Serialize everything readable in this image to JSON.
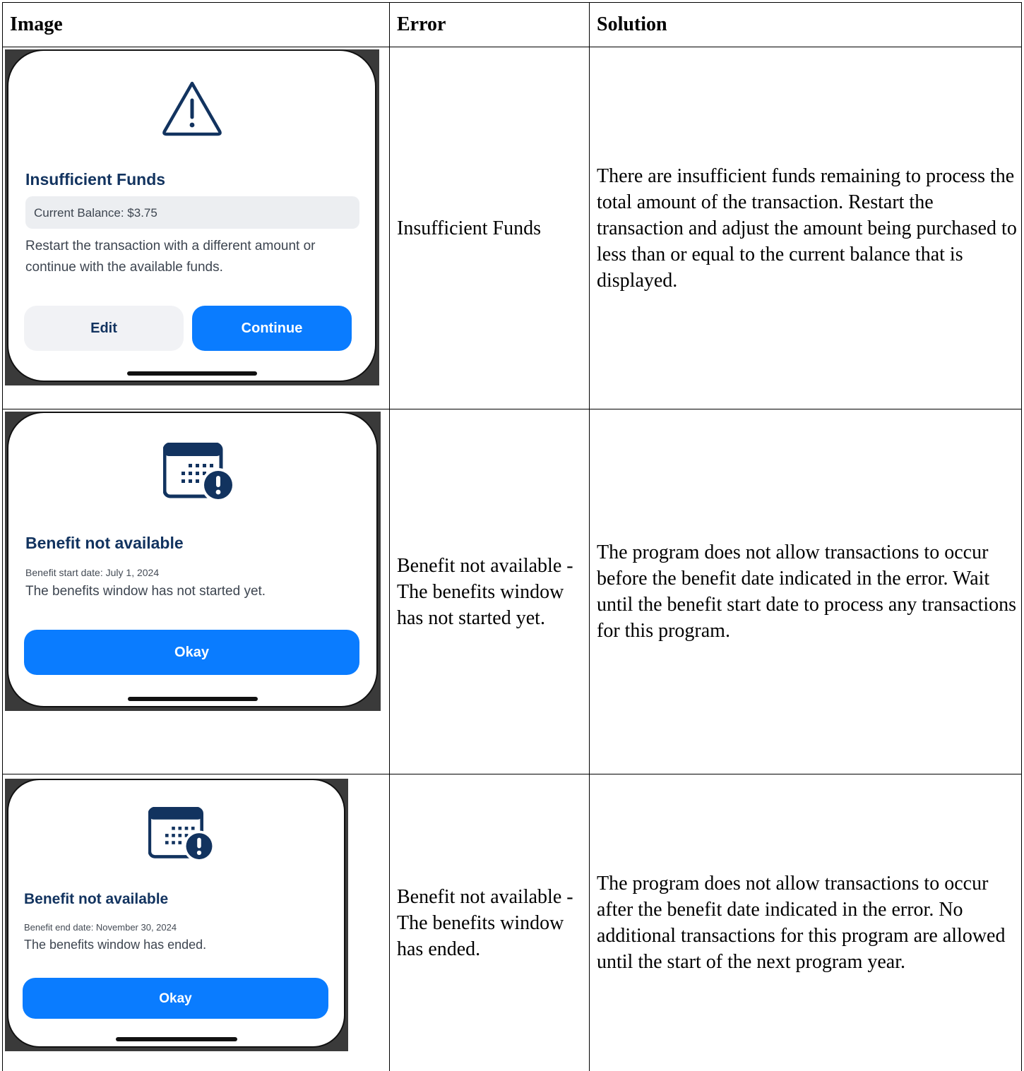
{
  "table": {
    "headers": [
      "Image",
      "Error",
      "Solution"
    ],
    "rows": [
      {
        "error": "Insufficient Funds",
        "solution": "There are insufficient funds remaining to process the total amount of the transaction. Restart the transaction and adjust the amount being purchased to less than or equal to the current balance that is displayed.",
        "dialog": {
          "icon": "warning-triangle-icon",
          "title": "Insufficient Funds",
          "balance": "Current Balance: $3.75",
          "body": "Restart the transaction with a different amount or continue with the available funds.",
          "buttons": [
            "Edit",
            "Continue"
          ]
        }
      },
      {
        "error": "Benefit not available - The benefits window has not started yet.",
        "solution": "The program does not allow transactions to occur before the benefit date indicated in the error. Wait until the benefit start date to process any transactions for this program.",
        "dialog": {
          "icon": "calendar-alert-icon",
          "title": "Benefit not available",
          "date_line": "Benefit start date: July 1, 2024",
          "body": "The benefits window has not started yet.",
          "button": "Okay"
        }
      },
      {
        "error": "Benefit not available - The benefits window has ended.",
        "solution": "The program does not allow transactions to occur after the benefit date indicated in the error. No additional transactions for this program are allowed until the start of the next program year.",
        "dialog": {
          "icon": "calendar-alert-icon",
          "title": "Benefit not available",
          "date_line": "Benefit end date: November 30, 2024",
          "body": "The benefits window has ended.",
          "button": "Okay"
        }
      }
    ]
  },
  "colors": {
    "title_navy": "#12335f",
    "button_blue": "#0a7cff",
    "pill_gray": "#eceef1"
  }
}
